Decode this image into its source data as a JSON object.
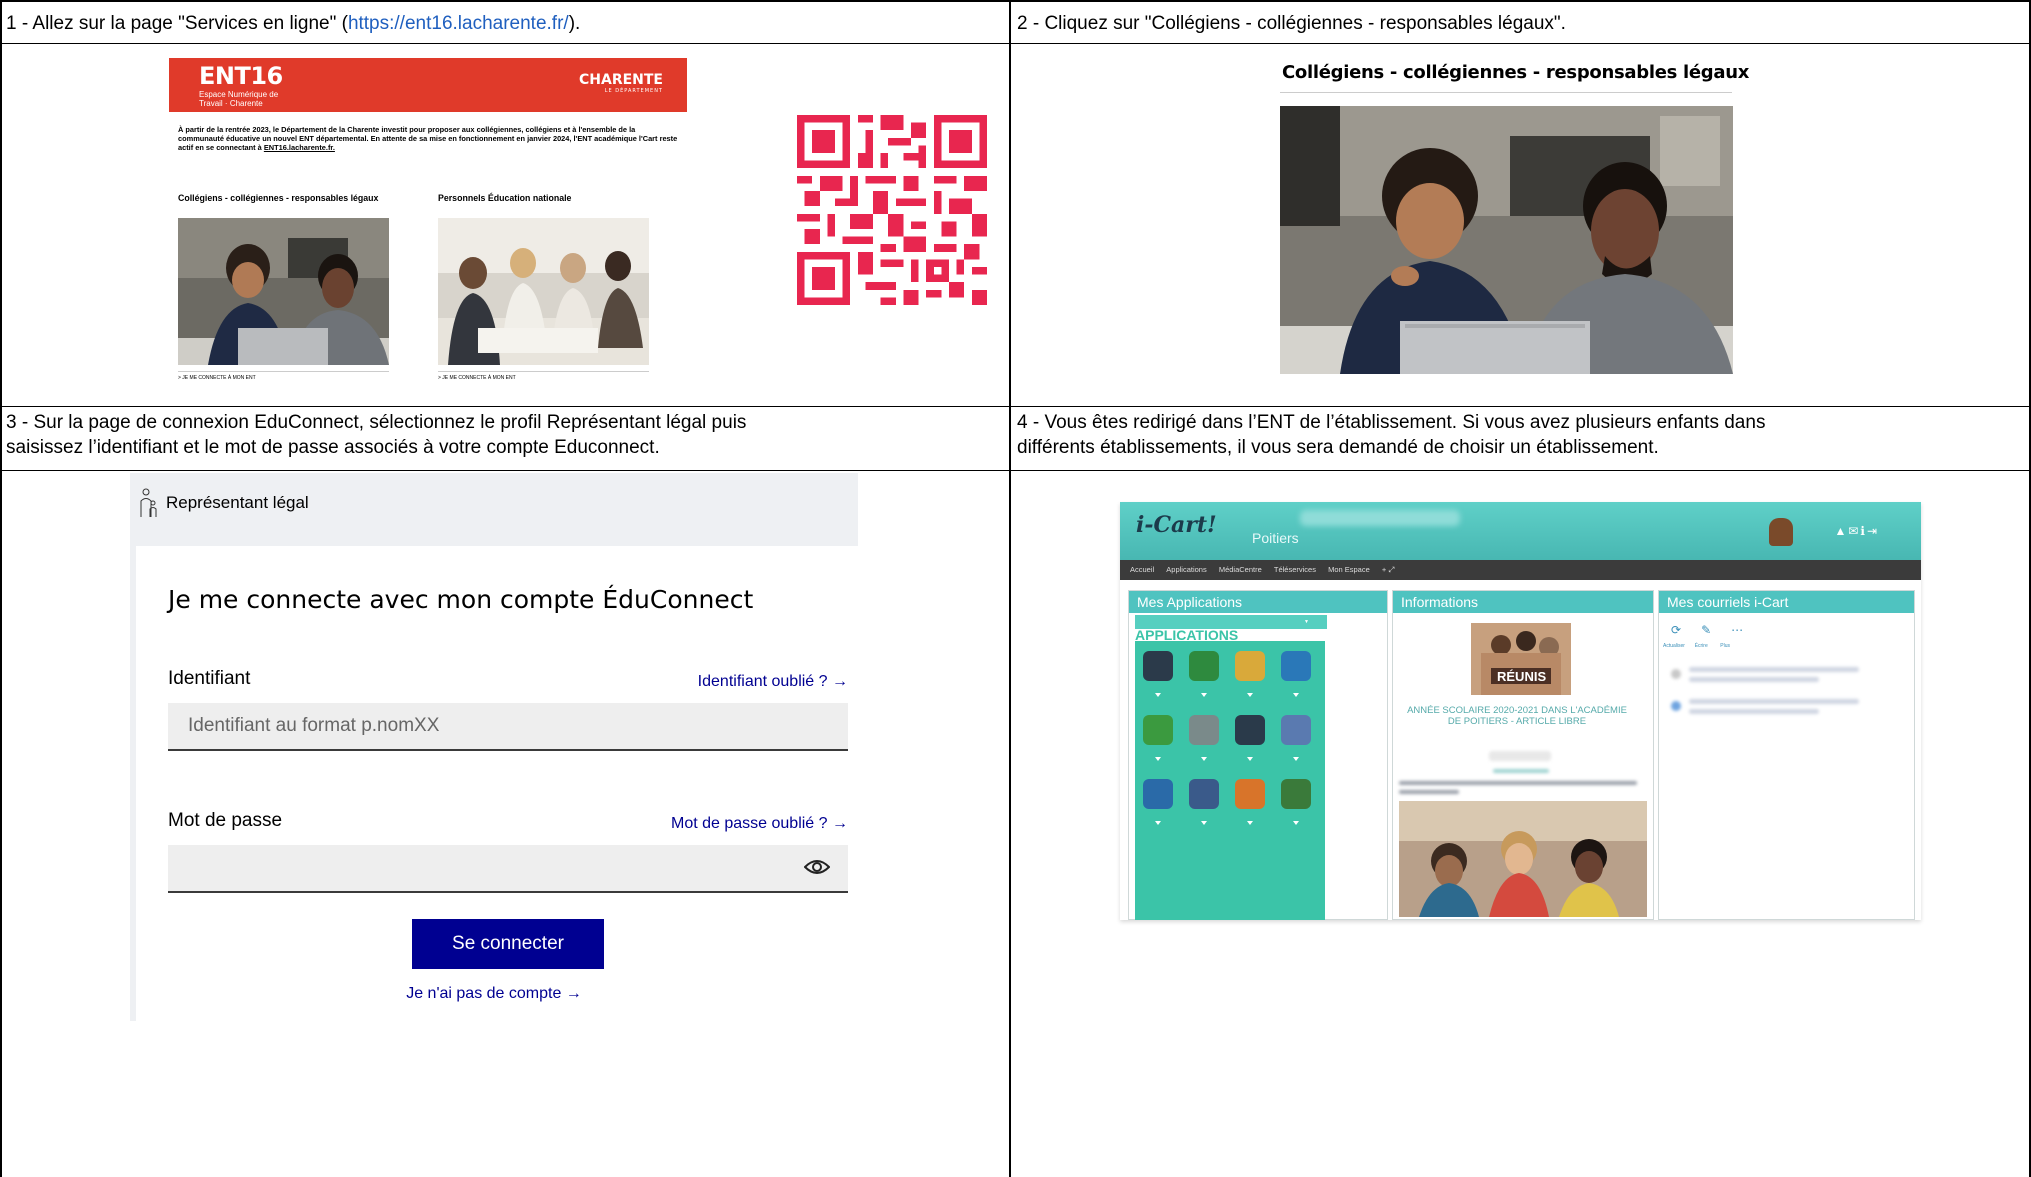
{
  "cells": [
    {
      "step": "1",
      "caption_before": "1 - Allez sur la page \"Services en ligne\" (",
      "caption_link": "https://ent16.lacharente.fr/",
      "caption_after": ")."
    },
    {
      "step": "2",
      "caption": "2 - Cliquez sur \"Collégiens - collégiennes - responsables légaux\"."
    },
    {
      "step": "3",
      "caption_line1": "3 - Sur la page de connexion EduConnect, sélectionnez le profil Représentant légal puis",
      "caption_line2": "saisissez l’identifiant et le mot de passe associés à votre compte Educonnect."
    },
    {
      "step": "4",
      "caption_line1": "4 - Vous êtes redirigé dans l’ENT de l’établissement. Si vous avez plusieurs enfants dans",
      "caption_line2": "différents établissements, il vous sera demandé de choisir un établissement."
    }
  ],
  "ent16": {
    "logo": "ENT16",
    "logo_sub": "Espace Numérique de Travail · Charente",
    "brand": "CHARENTE",
    "brand_sub": "LE DÉPARTEMENT",
    "intro": "À partir de la rentrée 2023, le Département de la Charente investit pour proposer aux collégiennes, collégiens et à l'ensemble de la communauté éducative un nouvel ENT départemental. En attente de sa mise en fonctionnement en janvier 2024, l'ENT académique l'Cart reste actif en se connectant à",
    "intro_link": "ENT16.lacharente.fr.",
    "section_left": "Collégiens - collégiennes - responsables légaux",
    "section_right": "Personnels Éducation nationale",
    "link_left": "> JE ME CONNECTE À MON ENT",
    "link_right": "> JE ME CONNECTE À MON ENT"
  },
  "cell2": {
    "title": "Collégiens - collégiennes - responsables légaux"
  },
  "educonnect": {
    "profile_label": "Représentant légal",
    "title": "Je me connecte avec mon compte ÉduConnect",
    "id_label": "Identifiant",
    "id_forgot": "Identifiant oublié ? →",
    "id_placeholder": "Identifiant au format p.nomXX",
    "pwd_label": "Mot de passe",
    "pwd_forgot": "Mot de passe oublié ? →",
    "submit": "Se connecter",
    "no_account": "Je n'ai pas de compte →"
  },
  "icart": {
    "logo": "i-Cart!",
    "city": "Poitiers",
    "nav": [
      "Accueil",
      "Applications",
      "MédiaCentre",
      "Téléservices",
      "Mon Espace"
    ],
    "col_apps": "Mes Applications",
    "apps_heading": "APPLICATIONS",
    "col_info": "Informations",
    "info_badge": "RÉUNIS",
    "info_title": "ANNÉE SCOLAIRE 2020-2021 DANS L'ACADÉMIE DE POITIERS - ARTICLE LIBRE",
    "col_mail": "Mes courriels i-Cart",
    "mail_actions": [
      "Actualiser",
      "Écrire",
      "Plus"
    ]
  },
  "colors": {
    "ent_red": "#e03a2a",
    "qr_pink": "#e8264f",
    "edu_blue": "#000091",
    "icart_teal": "#4fc3c0",
    "link_blue": "#1f5fbf"
  }
}
